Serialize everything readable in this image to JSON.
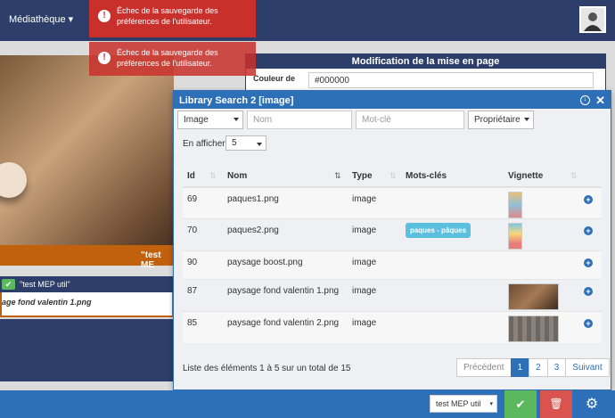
{
  "nav": {
    "menu_label": "Médiathèque ▾"
  },
  "toasts": [
    {
      "message": "Échec de la sauvegarde des préférences de l'utilisateur."
    },
    {
      "message": "Échec de la sauvegarde des préférences de l'utilisateur."
    }
  ],
  "left": {
    "banner_text": "\"test ME",
    "tag_label": "\"test MEP util\"",
    "subtitle": "age fond valentin 1.png"
  },
  "layout_panel": {
    "title": "Modification de la mise en page",
    "color_label": "Couleur de",
    "color_value": "#000000"
  },
  "library": {
    "title": "Library Search 2 [image]",
    "type_filter": "Image",
    "name_placeholder": "Nom",
    "keyword_placeholder": "Mot-clé",
    "owner_filter": "Propriétaire",
    "per_page_label": "En afficher",
    "per_page_value": "5",
    "columns": {
      "id": "Id",
      "name": "Nom",
      "type": "Type",
      "keywords": "Mots-clés",
      "thumb": "Vignette"
    },
    "rows": [
      {
        "id": "69",
        "name": "paques1.png",
        "type": "image",
        "keywords": ""
      },
      {
        "id": "70",
        "name": "paques2.png",
        "type": "image",
        "keywords": "paques - pâques"
      },
      {
        "id": "90",
        "name": "paysage boost.png",
        "type": "image",
        "keywords": ""
      },
      {
        "id": "87",
        "name": "paysage fond valentin 1.png",
        "type": "image",
        "keywords": ""
      },
      {
        "id": "85",
        "name": "paysage fond valentin 2.png",
        "type": "image",
        "keywords": ""
      }
    ],
    "footer_info": "Liste des éléments 1 à 5 sur un total de 15",
    "pager": {
      "prev": "Précédent",
      "p1": "1",
      "p2": "2",
      "p3": "3",
      "next": "Suivant"
    }
  },
  "bottom": {
    "dropdown_value": "test MEP util"
  }
}
